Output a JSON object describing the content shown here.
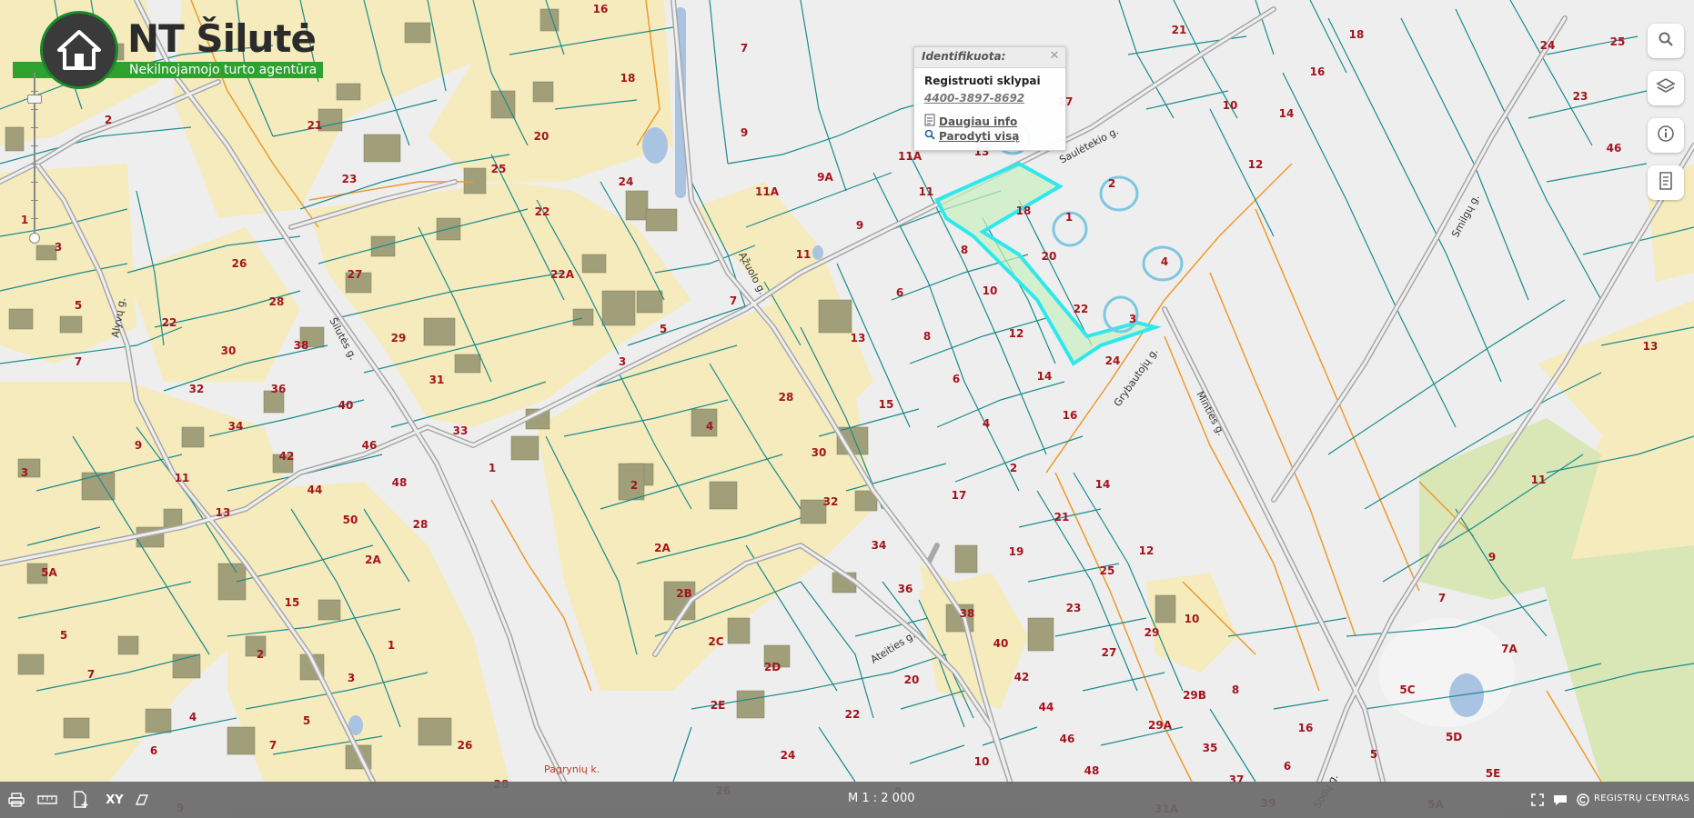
{
  "logo": {
    "title": "NT Šilutė",
    "subtitle": "Nekilnojamojo turto agentūra",
    "icon": "house-icon"
  },
  "popup": {
    "header": "Identifikuota:",
    "title": "Registruoti sklypai",
    "parcel_number": "4400-3897-8692",
    "more_info": "Daugiau info",
    "show_all": "Parodyti visą"
  },
  "toolbar": {
    "items": [
      {
        "icon": "search-icon"
      },
      {
        "icon": "layers-icon"
      },
      {
        "icon": "info-icon"
      },
      {
        "icon": "legend-icon"
      }
    ]
  },
  "bottombar": {
    "scale": "M 1 : 2 000",
    "xy_label": "XY",
    "brand": "REGISTRŲ CENTRAS",
    "icons": [
      "print-icon",
      "measure-icon",
      "add-document-icon",
      "coordinates-icon",
      "eraser-icon",
      "fullscreen-icon",
      "chat-icon",
      "copyright-icon"
    ]
  },
  "map": {
    "streets": [
      "Šilutės g.",
      "Ąžuolo g.",
      "Saulėtekio g.",
      "Grybautojų g.",
      "Minties g.",
      "Smilgų g.",
      "Ateities g.",
      "Alyvų g."
    ],
    "places": [
      "Pagrynių k."
    ],
    "parcels": [
      "16",
      "18",
      "21",
      "23",
      "25",
      "20",
      "24",
      "22",
      "22A",
      "7",
      "5",
      "3",
      "1",
      "2",
      "26",
      "28",
      "27",
      "29",
      "31",
      "33",
      "30",
      "32",
      "36",
      "34",
      "38",
      "40",
      "42",
      "44",
      "46",
      "48",
      "28",
      "50",
      "2A",
      "2B",
      "2C",
      "2D",
      "2E",
      "4",
      "13",
      "15",
      "11",
      "9A",
      "9",
      "11A",
      "11",
      "6",
      "8",
      "10",
      "12",
      "14",
      "16",
      "17",
      "19",
      "21",
      "25",
      "23",
      "27",
      "29",
      "29A",
      "29B",
      "35",
      "37",
      "39",
      "31A",
      "10",
      "8",
      "6",
      "4",
      "2",
      "17",
      "9",
      "11",
      "7",
      "5",
      "3",
      "2",
      "1",
      "5A",
      "24",
      "22",
      "20",
      "10",
      "8",
      "26",
      "38",
      "40",
      "42",
      "44",
      "46",
      "48",
      "12",
      "14",
      "10",
      "18",
      "21",
      "24",
      "25",
      "23",
      "46",
      "16",
      "13",
      "11",
      "9",
      "7",
      "7A",
      "5C",
      "5D",
      "5E",
      "5A",
      "5",
      "6",
      "16",
      "1",
      "2",
      "3",
      "4",
      "17",
      "13",
      "20",
      "22",
      "24"
    ]
  }
}
